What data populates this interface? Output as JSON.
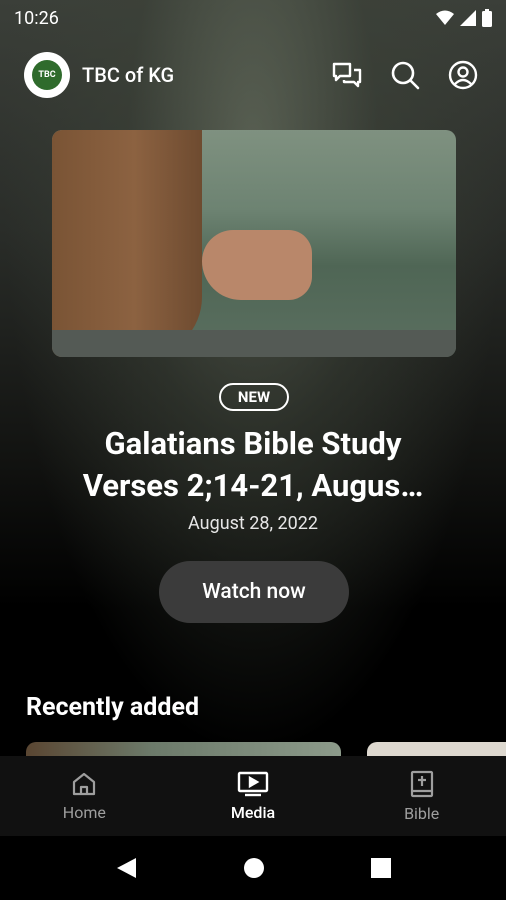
{
  "status_bar": {
    "time": "10:26",
    "icons": [
      "wifi-icon",
      "signal-icon",
      "battery-icon"
    ]
  },
  "app": {
    "name": "TBC of KG",
    "logo_text": "TBC"
  },
  "header_actions": [
    "messages-icon",
    "search-icon",
    "account-icon"
  ],
  "hero": {
    "badge": "NEW",
    "title_line1": "Galatians Bible Study",
    "title_line2": "Verses 2;14-21, Augus…",
    "date": "August 28, 2022",
    "cta": "Watch now"
  },
  "sections": {
    "recently_added": "Recently added"
  },
  "bottom_nav": [
    {
      "label": "Home",
      "icon": "home-icon",
      "active": false
    },
    {
      "label": "Media",
      "icon": "media-icon",
      "active": true
    },
    {
      "label": "Bible",
      "icon": "bible-icon",
      "active": false
    }
  ],
  "colors": {
    "background": "#000000",
    "button": "#3b3b3b",
    "nav_bg": "#111111",
    "inactive": "#9e9e9e"
  }
}
